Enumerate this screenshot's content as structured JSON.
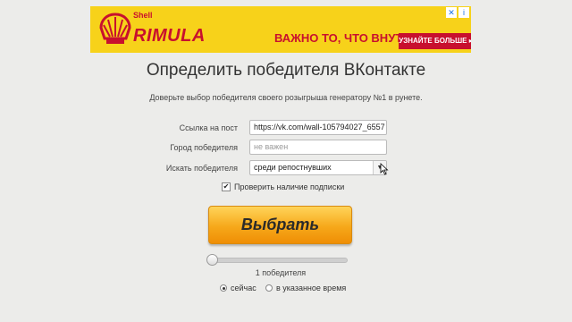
{
  "ad": {
    "shell_text": "Shell",
    "brand": "RIMULA",
    "slogan": "ВАЖНО ТО, ЧТО ВНУТРИ",
    "cta": "УЗНАЙТЕ БОЛЬШЕ ▸",
    "adchoice_icon": "info-icon",
    "close_icon": "close-icon"
  },
  "page": {
    "title": "Определить победителя ВКонтакте",
    "subtitle": "Доверьте выбор победителя своего розыгрыша генератору №1 в рунете."
  },
  "form": {
    "post_link": {
      "label": "Ссылка на пост",
      "value": "https://vk.com/wall-105794027_6557"
    },
    "city": {
      "label": "Город победителя",
      "placeholder": "не важен"
    },
    "search": {
      "label": "Искать победителя",
      "value": "среди репостнувших"
    },
    "check_subscription": {
      "label": "Проверить наличие подписки",
      "checked": true
    }
  },
  "actions": {
    "choose_label": "Выбрать"
  },
  "winners": {
    "count_label": "1 победителя",
    "slider_value": 1
  },
  "timing": {
    "now_label": "сейчас",
    "scheduled_label": "в указанное время",
    "selected": "now"
  },
  "colors": {
    "ad_bg": "#f7d21a",
    "brand_red": "#c8102e",
    "button_orange": "#f6a81a",
    "page_bg": "#ececea"
  }
}
